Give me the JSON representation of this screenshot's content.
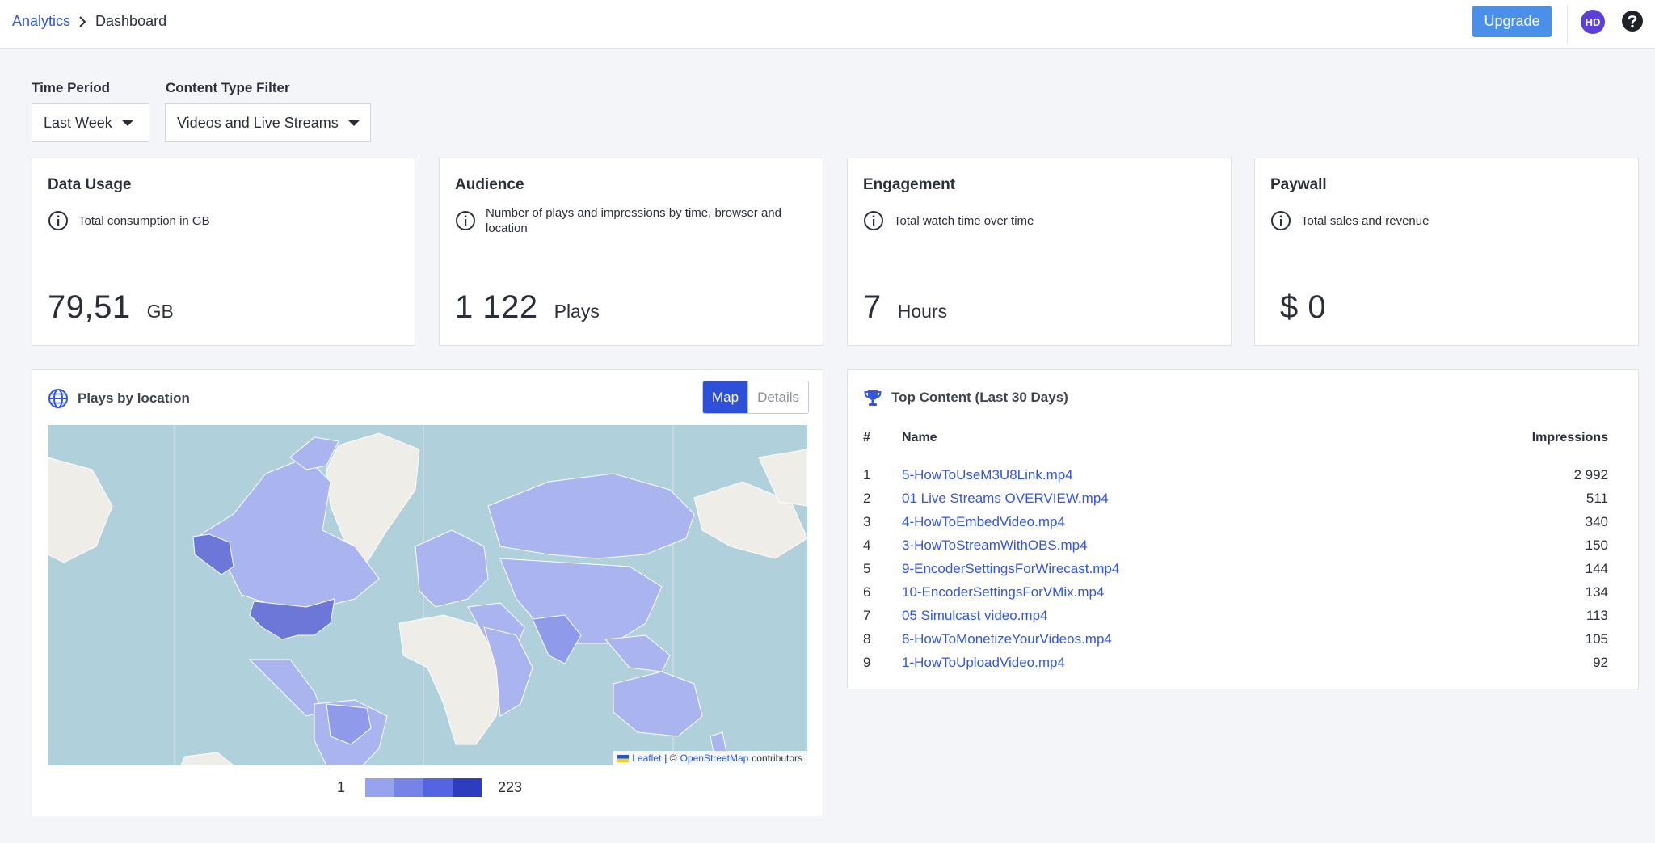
{
  "breadcrumb": {
    "root": "Analytics",
    "current": "Dashboard"
  },
  "header": {
    "upgrade_label": "Upgrade",
    "avatar_initials": "HD"
  },
  "filters": {
    "time_period": {
      "label": "Time Period",
      "value": "Last Week"
    },
    "content_type": {
      "label": "Content Type Filter",
      "value": "Videos and Live Streams"
    }
  },
  "cards": {
    "data_usage": {
      "title": "Data Usage",
      "description": "Total consumption in GB",
      "value": "79,51",
      "unit": "GB"
    },
    "audience": {
      "title": "Audience",
      "description": "Number of plays and impressions by time, browser and location",
      "value": "1 122",
      "unit": "Plays"
    },
    "engagement": {
      "title": "Engagement",
      "description": "Total watch time over time",
      "value": "7",
      "unit": "Hours"
    },
    "paywall": {
      "title": "Paywall",
      "description": "Total sales and revenue",
      "value": "$ 0"
    }
  },
  "map_panel": {
    "title": "Plays by location",
    "toggle": {
      "map": "Map",
      "details": "Details",
      "selected": "Map"
    },
    "attribution": {
      "leaflet": "Leaflet",
      "separator": "| ©",
      "osm": "OpenStreetMap",
      "suffix": "contributors"
    },
    "legend": {
      "min": "1",
      "max": "223",
      "colors": [
        "#98a3ee",
        "#7684ea",
        "#5564e3",
        "#2d3cc0"
      ]
    },
    "colors": {
      "water": "#b0d1dc",
      "land": "#eeede8",
      "low": "#aab4ef",
      "mid": "#8f9bea",
      "high": "#6b78d8"
    }
  },
  "top_content": {
    "title": "Top Content (Last 30 Days)",
    "columns": {
      "rank": "#",
      "name": "Name",
      "impressions": "Impressions"
    },
    "rows": [
      {
        "rank": "1",
        "name": "5-HowToUseM3U8Link.mp4",
        "impressions": "2 992"
      },
      {
        "rank": "2",
        "name": "01 Live Streams OVERVIEW.mp4",
        "impressions": "511"
      },
      {
        "rank": "3",
        "name": "4-HowToEmbedVideo.mp4",
        "impressions": "340"
      },
      {
        "rank": "4",
        "name": "3-HowToStreamWithOBS.mp4",
        "impressions": "150"
      },
      {
        "rank": "5",
        "name": "9-EncoderSettingsForWirecast.mp4",
        "impressions": "144"
      },
      {
        "rank": "6",
        "name": "10-EncoderSettingsForVMix.mp4",
        "impressions": "134"
      },
      {
        "rank": "7",
        "name": "05 Simulcast video.mp4",
        "impressions": "113"
      },
      {
        "rank": "8",
        "name": "6-HowToMonetizeYourVideos.mp4",
        "impressions": "105"
      },
      {
        "rank": "9",
        "name": "1-HowToUploadVideo.mp4",
        "impressions": "92"
      }
    ]
  },
  "theme": {
    "accent": "#3356e0",
    "upgrade": "#4a90e8",
    "avatar": "#5b3fd6"
  },
  "icons": [
    "chevron-right-icon",
    "help-icon",
    "caret-down-icon",
    "info-icon",
    "globe-icon",
    "trophy-icon",
    "ukraine-flag-icon"
  ]
}
